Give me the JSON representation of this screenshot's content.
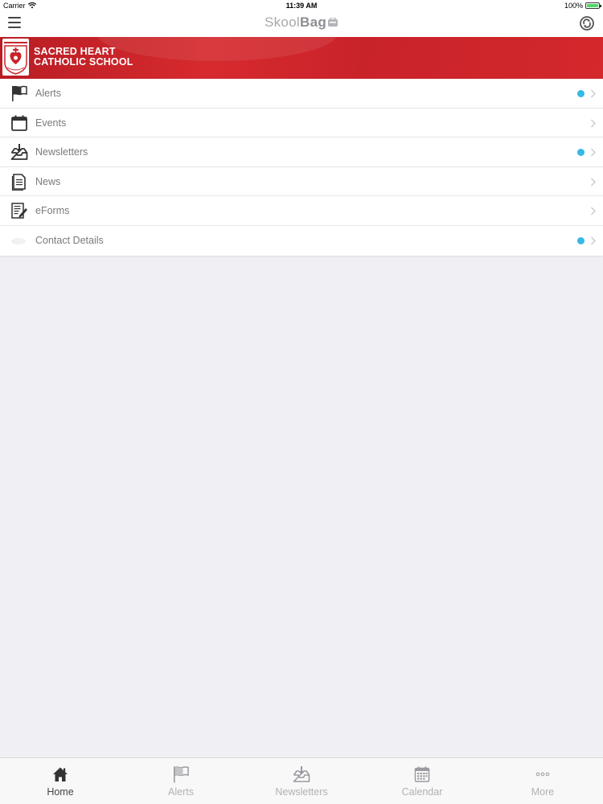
{
  "status_bar": {
    "carrier": "Carrier",
    "time": "11:39 AM",
    "battery": "100%"
  },
  "header": {
    "brand_light": "Skool",
    "brand_bold": "Bag"
  },
  "school": {
    "name_line1": "SACRED HEART",
    "name_line2": "CATHOLIC SCHOOL"
  },
  "menu": [
    {
      "label": "Alerts",
      "icon": "flag-icon",
      "unread": true
    },
    {
      "label": "Events",
      "icon": "calendar-icon",
      "unread": false
    },
    {
      "label": "Newsletters",
      "icon": "inbox-download-icon",
      "unread": true
    },
    {
      "label": "News",
      "icon": "document-icon",
      "unread": false
    },
    {
      "label": "eForms",
      "icon": "form-edit-icon",
      "unread": false
    },
    {
      "label": "Contact Details",
      "icon": "contact-icon",
      "unread": true
    }
  ],
  "tabs": [
    {
      "label": "Home",
      "icon": "home-icon",
      "active": true
    },
    {
      "label": "Alerts",
      "icon": "flag-icon",
      "active": false
    },
    {
      "label": "Newsletters",
      "icon": "inbox-download-icon",
      "active": false
    },
    {
      "label": "Calendar",
      "icon": "calendar-grid-icon",
      "active": false
    },
    {
      "label": "More",
      "icon": "more-icon",
      "active": false
    }
  ],
  "colors": {
    "banner_red": "#c9232a",
    "unread_dot": "#36b8e8",
    "background": "#efeff4"
  }
}
